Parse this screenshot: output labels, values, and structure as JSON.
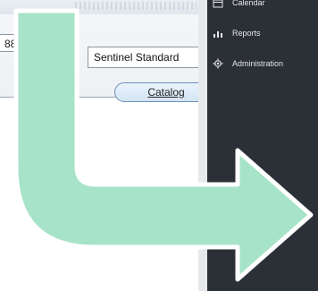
{
  "app": {
    "left_field_value": "88",
    "main_field_value": "Sentinel Standard",
    "catalog_button": "Catalog"
  },
  "sidebar": {
    "items": [
      {
        "label": "Calendar",
        "icon": "calendar-icon"
      },
      {
        "label": "Reports",
        "icon": "reports-icon"
      },
      {
        "label": "Administration",
        "icon": "gear-icon"
      }
    ]
  },
  "colors": {
    "sidebar_bg": "#2b2f36",
    "arrow_fill": "#a7e3c8",
    "arrow_stroke": "#ffffff"
  }
}
